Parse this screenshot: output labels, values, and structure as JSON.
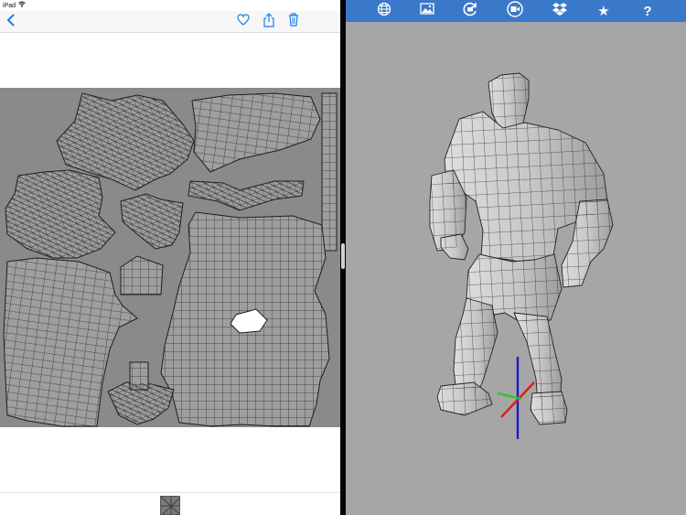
{
  "status_bar": {
    "device": "iPad",
    "wifi_icon": "wifi-icon"
  },
  "photos_nav": {
    "back_icon": "chevron-left-icon",
    "favorite_icon": "heart-icon",
    "share_icon": "share-icon",
    "delete_icon": "trash-icon"
  },
  "viewer_toolbar": {
    "items": [
      {
        "name": "globe-icon"
      },
      {
        "name": "image-icon"
      },
      {
        "name": "reset-view-icon"
      },
      {
        "name": "record-video-icon"
      },
      {
        "name": "dropbox-icon"
      },
      {
        "name": "star-icon",
        "glyph": "★"
      },
      {
        "name": "help-icon",
        "glyph": "?"
      }
    ]
  },
  "colors": {
    "toolbar_bg": "#3a79c9",
    "viewport_bg": "#a6a6a6",
    "uv_bg": "#8a8a8a",
    "mesh_fill": "#9e9e9e",
    "accent_ios": "#1a7cf0",
    "axis_x": "#dd1a1a",
    "axis_y": "#1a1acc",
    "axis_z": "#22cc22"
  }
}
